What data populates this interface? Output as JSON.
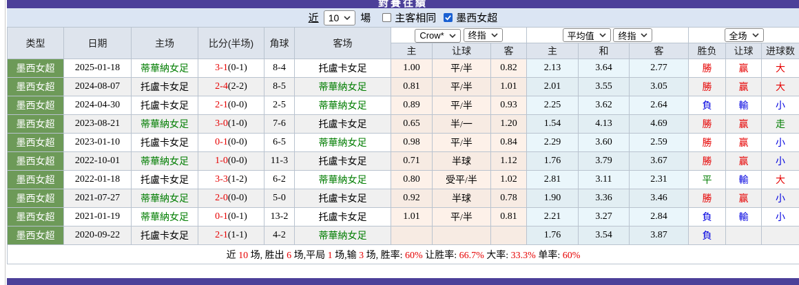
{
  "page": {
    "clipped_title": "對賽往績",
    "accent_purple": "#4c4099",
    "badge_green": "#6d9a58"
  },
  "filter": {
    "near_label": "近",
    "games_count": "10",
    "games_unit": "場",
    "checkbox_same": {
      "label": "主客相同",
      "checked": false
    },
    "checkbox_league": {
      "label": "墨西女超",
      "checked": true
    }
  },
  "table": {
    "columns": {
      "type": "类型",
      "date": "日期",
      "home": "主场",
      "score": "比分(半场)",
      "corner": "角球",
      "away": "客场"
    },
    "group_selects": {
      "bookmaker": "Crow*",
      "book_stage": "终指",
      "average": "平均值",
      "avg_stage": "终指",
      "scope": "全场"
    },
    "sub_columns": {
      "crow": [
        "主",
        "让球",
        "客"
      ],
      "avg": [
        "主",
        "和",
        "客"
      ],
      "result": [
        "胜负",
        "让球",
        "进球数"
      ]
    },
    "rows": [
      {
        "league": "墨西女超",
        "date": "2025-01-18",
        "home": {
          "t": "蒂華納女足",
          "c": "g"
        },
        "score_ft": "3-1",
        "score_ht": "(0-1)",
        "corner": "8-4",
        "away": {
          "t": "托盧卡女足",
          "c": "k"
        },
        "crow": [
          "1.00",
          "平/半",
          "0.82"
        ],
        "avg": [
          "2.13",
          "3.64",
          "2.77"
        ],
        "res": [
          {
            "t": "勝",
            "c": "r"
          },
          {
            "t": "赢",
            "c": "r"
          },
          {
            "t": "大",
            "c": "r"
          }
        ]
      },
      {
        "league": "墨西女超",
        "date": "2024-08-07",
        "home": {
          "t": "托盧卡女足",
          "c": "k"
        },
        "score_ft": "2-4",
        "score_ht": "(2-2)",
        "corner": "8-5",
        "away": {
          "t": "蒂華納女足",
          "c": "g"
        },
        "crow": [
          "0.81",
          "平/半",
          "1.01"
        ],
        "avg": [
          "2.01",
          "3.55",
          "3.05"
        ],
        "res": [
          {
            "t": "勝",
            "c": "r"
          },
          {
            "t": "赢",
            "c": "r"
          },
          {
            "t": "大",
            "c": "r"
          }
        ]
      },
      {
        "league": "墨西女超",
        "date": "2024-04-30",
        "home": {
          "t": "托盧卡女足",
          "c": "k"
        },
        "score_ft": "2-1",
        "score_ht": "(0-0)",
        "corner": "2-5",
        "away": {
          "t": "蒂華納女足",
          "c": "g"
        },
        "crow": [
          "0.89",
          "平/半",
          "0.93"
        ],
        "avg": [
          "2.25",
          "3.62",
          "2.64"
        ],
        "res": [
          {
            "t": "負",
            "c": "b"
          },
          {
            "t": "輸",
            "c": "b"
          },
          {
            "t": "小",
            "c": "b"
          }
        ]
      },
      {
        "league": "墨西女超",
        "date": "2023-08-21",
        "home": {
          "t": "蒂華納女足",
          "c": "g"
        },
        "score_ft": "3-0",
        "score_ht": "(1-0)",
        "corner": "7-6",
        "away": {
          "t": "托盧卡女足",
          "c": "k"
        },
        "crow": [
          "0.65",
          "半/一",
          "1.20"
        ],
        "avg": [
          "1.54",
          "4.13",
          "4.69"
        ],
        "res": [
          {
            "t": "勝",
            "c": "r"
          },
          {
            "t": "赢",
            "c": "r"
          },
          {
            "t": "走",
            "c": "g"
          }
        ]
      },
      {
        "league": "墨西女超",
        "date": "2023-01-10",
        "home": {
          "t": "托盧卡女足",
          "c": "k"
        },
        "score_ft": "0-1",
        "score_ht": "(0-0)",
        "corner": "6-5",
        "away": {
          "t": "蒂華納女足",
          "c": "g"
        },
        "crow": [
          "0.98",
          "平/半",
          "0.84"
        ],
        "avg": [
          "2.29",
          "3.60",
          "2.59"
        ],
        "res": [
          {
            "t": "勝",
            "c": "r"
          },
          {
            "t": "赢",
            "c": "r"
          },
          {
            "t": "小",
            "c": "b"
          }
        ]
      },
      {
        "league": "墨西女超",
        "date": "2022-10-01",
        "home": {
          "t": "蒂華納女足",
          "c": "g"
        },
        "score_ft": "1-0",
        "score_ht": "(0-0)",
        "corner": "11-3",
        "away": {
          "t": "托盧卡女足",
          "c": "k"
        },
        "crow": [
          "0.71",
          "半球",
          "1.12"
        ],
        "avg": [
          "1.76",
          "3.79",
          "3.67"
        ],
        "res": [
          {
            "t": "勝",
            "c": "r"
          },
          {
            "t": "赢",
            "c": "r"
          },
          {
            "t": "小",
            "c": "b"
          }
        ]
      },
      {
        "league": "墨西女超",
        "date": "2022-01-18",
        "home": {
          "t": "托盧卡女足",
          "c": "k"
        },
        "score_ft": "3-3",
        "score_ht": "(1-2)",
        "corner": "6-2",
        "away": {
          "t": "蒂華納女足",
          "c": "g"
        },
        "crow": [
          "0.80",
          "受平/半",
          "1.02"
        ],
        "avg": [
          "2.81",
          "3.11",
          "2.31"
        ],
        "res": [
          {
            "t": "平",
            "c": "g"
          },
          {
            "t": "輸",
            "c": "b"
          },
          {
            "t": "大",
            "c": "r"
          }
        ]
      },
      {
        "league": "墨西女超",
        "date": "2021-07-27",
        "home": {
          "t": "蒂華納女足",
          "c": "g"
        },
        "score_ft": "2-0",
        "score_ht": "(0-0)",
        "corner": "5-0",
        "away": {
          "t": "托盧卡女足",
          "c": "k"
        },
        "crow": [
          "0.92",
          "半球",
          "0.78"
        ],
        "avg": [
          "1.90",
          "3.36",
          "3.46"
        ],
        "res": [
          {
            "t": "勝",
            "c": "r"
          },
          {
            "t": "赢",
            "c": "r"
          },
          {
            "t": "小",
            "c": "b"
          }
        ]
      },
      {
        "league": "墨西女超",
        "date": "2021-01-19",
        "home": {
          "t": "蒂華納女足",
          "c": "g"
        },
        "score_ft": "0-1",
        "score_ht": "(0-1)",
        "corner": "13-2",
        "away": {
          "t": "托盧卡女足",
          "c": "k"
        },
        "crow": [
          "1.01",
          "平/半",
          "0.81"
        ],
        "avg": [
          "2.21",
          "3.27",
          "2.84"
        ],
        "res": [
          {
            "t": "負",
            "c": "b"
          },
          {
            "t": "輸",
            "c": "b"
          },
          {
            "t": "小",
            "c": "b"
          }
        ]
      },
      {
        "league": "墨西女超",
        "date": "2020-09-22",
        "home": {
          "t": "托盧卡女足",
          "c": "k"
        },
        "score_ft": "2-1",
        "score_ht": "(1-1)",
        "corner": "4-2",
        "away": {
          "t": "蒂華納女足",
          "c": "g"
        },
        "crow": [
          "",
          "",
          ""
        ],
        "avg": [
          "1.76",
          "3.54",
          "3.87"
        ],
        "res": [
          {
            "t": "負",
            "c": "b"
          },
          {
            "t": "",
            "c": "k"
          },
          {
            "t": "",
            "c": "k"
          }
        ]
      }
    ],
    "summary": [
      {
        "t": "近 ",
        "c": "k"
      },
      {
        "t": "10",
        "c": "r"
      },
      {
        "t": " 场, 胜出 ",
        "c": "k"
      },
      {
        "t": "6",
        "c": "r"
      },
      {
        "t": " 场,平局 ",
        "c": "k"
      },
      {
        "t": "1",
        "c": "r"
      },
      {
        "t": " 场,输 ",
        "c": "k"
      },
      {
        "t": "3",
        "c": "r"
      },
      {
        "t": " 场, 胜率: ",
        "c": "k"
      },
      {
        "t": "60%",
        "c": "r"
      },
      {
        "t": " 让胜率: ",
        "c": "k"
      },
      {
        "t": "66.7%",
        "c": "r"
      },
      {
        "t": " 大率: ",
        "c": "k"
      },
      {
        "t": "33.3%",
        "c": "r"
      },
      {
        "t": " 单率: ",
        "c": "k"
      },
      {
        "t": "60%",
        "c": "r"
      }
    ]
  }
}
